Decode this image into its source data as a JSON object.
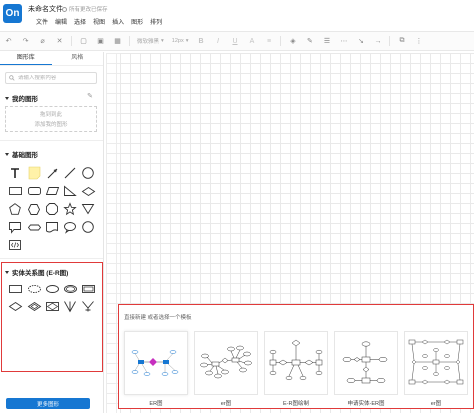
{
  "app": {
    "logo_text": "On",
    "doc_title": "未命名文件",
    "save_status": "所有更改已保存"
  },
  "menu": [
    "文件",
    "编辑",
    "选择",
    "视图",
    "插入",
    "图形",
    "排列"
  ],
  "toolbar": {
    "font_family": "微软雅黑",
    "font_size": "12px"
  },
  "sidebar": {
    "tabs": [
      "图形库",
      "风格"
    ],
    "search_placeholder": "请输入搜索内容",
    "my_shapes": {
      "title": "我的图形",
      "hint_line1": "拖到到此",
      "hint_line2": "添加我的图形"
    },
    "basic_shapes": {
      "title": "基础图形"
    },
    "er_shapes": {
      "title": "实体关系图 (E-R图)"
    },
    "more_button": "更多图形"
  },
  "templates": {
    "hint": "直接新建 或者选择一个模板",
    "items": [
      {
        "label": "ER图"
      },
      {
        "label": "er图"
      },
      {
        "label": "E-R图绘制"
      },
      {
        "label": "申请实体-ER图"
      },
      {
        "label": "er图"
      }
    ]
  },
  "colors": {
    "accent": "#1677d2",
    "highlight_border": "#e03a3a",
    "sticky_note": "#fff2a8"
  }
}
